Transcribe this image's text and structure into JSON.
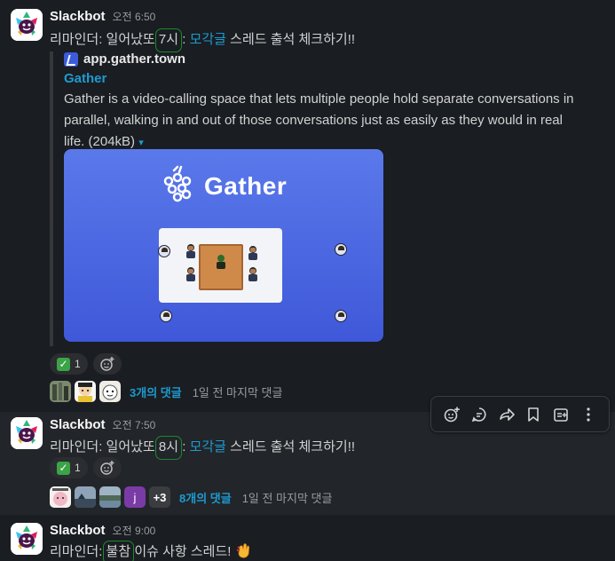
{
  "messages": [
    {
      "author": "Slackbot",
      "time": "오전 6:50",
      "text_before": "리마인더: 일어났또 ",
      "highlight": "7시",
      "text_middle": " : ",
      "link": "모각글",
      "text_after": " 스레드 출석 체크하기!!",
      "unfurl": {
        "site": "app.gather.town",
        "title": "Gather",
        "description": "Gather is a video-calling space that lets multiple people hold separate conversations in parallel, walking in and out of those conversations just as easily as they would in real life. (204kB)",
        "caret": "▾",
        "preview_logo_text": "Gather"
      },
      "reaction": {
        "emoji": "✓",
        "count": "1"
      },
      "thread": {
        "replies": "3개의 댓글",
        "last_reply": "1일 전 마지막 댓글"
      }
    },
    {
      "author": "Slackbot",
      "time": "오전 7:50",
      "text_before": "리마인더: 일어났또 ",
      "highlight": "8시",
      "text_middle": " : ",
      "link": "모각글",
      "text_after": " 스레드 출석 체크하기!!",
      "reaction": {
        "emoji": "✓",
        "count": "1"
      },
      "thread": {
        "replies": "8개의 댓글",
        "last_reply": "1일 전 마지막 댓글",
        "avatar_j": "j",
        "more": "+3"
      }
    },
    {
      "author": "Slackbot",
      "time": "오전 9:00",
      "text_before": "리마인더: ",
      "highlight": "불참",
      "text_after": " 이슈 사항 스레드! "
    }
  ],
  "toolbar": {
    "icons": [
      "add-reaction-icon",
      "reply-in-thread-icon",
      "forward-icon",
      "bookmark-icon",
      "add-to-list-icon",
      "more-actions-icon"
    ]
  },
  "colors": {
    "background": "#1a1d21",
    "hover_background": "#222529",
    "link": "#1d9bd1",
    "highlight_ink": "#1b8a2e",
    "check_green": "#3aa446"
  }
}
